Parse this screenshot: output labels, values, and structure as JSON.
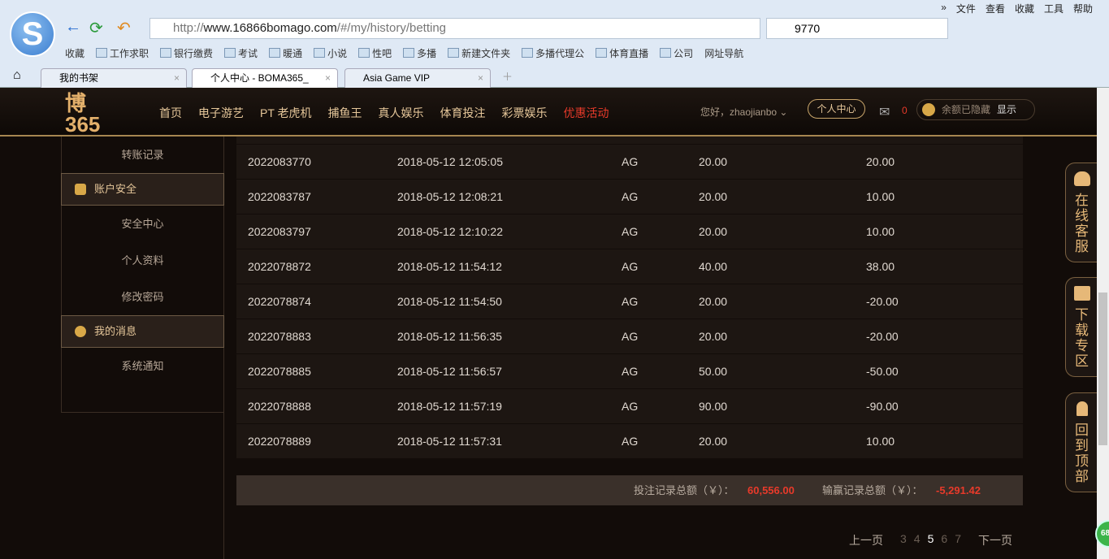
{
  "browser": {
    "url_host": "http://",
    "url_main": "www.16866bomago.com",
    "url_path": "/#/my/history/betting",
    "search_value": "9770",
    "menu": [
      "»",
      "文件",
      "查看",
      "收藏",
      "工具",
      "帮助"
    ],
    "bookmarks": [
      "收藏",
      "工作求职",
      "银行缴费",
      "考试",
      "暖通",
      "小说",
      "性吧",
      "多播",
      "新建文件夹",
      "多播代理公",
      "体育直播",
      "公司",
      "网址导航"
    ],
    "tabs": [
      "我的书架",
      "个人中心 - BOMA365_",
      "Asia Game VIP"
    ]
  },
  "site": {
    "logo": "博365",
    "nav": [
      "首页",
      "电子游艺",
      "PT 老虎机",
      "捕鱼王",
      "真人娱乐",
      "体育投注",
      "彩票娱乐",
      "优惠活动"
    ],
    "greeting": "您好，zhaojianbo",
    "user_center": "个人中心",
    "mail_count": "0",
    "balance_hidden": "余额已隐藏",
    "show": "显示"
  },
  "sidebar": {
    "transfer": "转账记录",
    "security": "账户安全",
    "security_items": [
      "安全中心",
      "个人资料",
      "修改密码"
    ],
    "messages": "我的消息",
    "message_items": [
      "系统通知"
    ]
  },
  "rows": [
    [
      "2022083770",
      "2018-05-12 12:05:05",
      "AG",
      "20.00",
      "20.00"
    ],
    [
      "2022083787",
      "2018-05-12 12:08:21",
      "AG",
      "20.00",
      "10.00"
    ],
    [
      "2022083797",
      "2018-05-12 12:10:22",
      "AG",
      "20.00",
      "10.00"
    ],
    [
      "2022078872",
      "2018-05-12 11:54:12",
      "AG",
      "40.00",
      "38.00"
    ],
    [
      "2022078874",
      "2018-05-12 11:54:50",
      "AG",
      "20.00",
      "-20.00"
    ],
    [
      "2022078883",
      "2018-05-12 11:56:35",
      "AG",
      "20.00",
      "-20.00"
    ],
    [
      "2022078885",
      "2018-05-12 11:56:57",
      "AG",
      "50.00",
      "-50.00"
    ],
    [
      "2022078888",
      "2018-05-12 11:57:19",
      "AG",
      "90.00",
      "-90.00"
    ],
    [
      "2022078889",
      "2018-05-12 11:57:31",
      "AG",
      "20.00",
      "10.00"
    ]
  ],
  "summary": {
    "bet_label": "投注记录总额（￥）：",
    "bet_total": "60,556.00",
    "win_label": "输赢记录总额（￥）：",
    "win_total": "-5,291.42"
  },
  "pager": {
    "prev": "上一页",
    "pages": [
      "3",
      "4",
      "5",
      "6",
      "7"
    ],
    "current": "5",
    "next": "下一页"
  },
  "float": {
    "service": "在线客服",
    "download": "下载专区",
    "top": "回到顶部"
  },
  "badge": "68"
}
